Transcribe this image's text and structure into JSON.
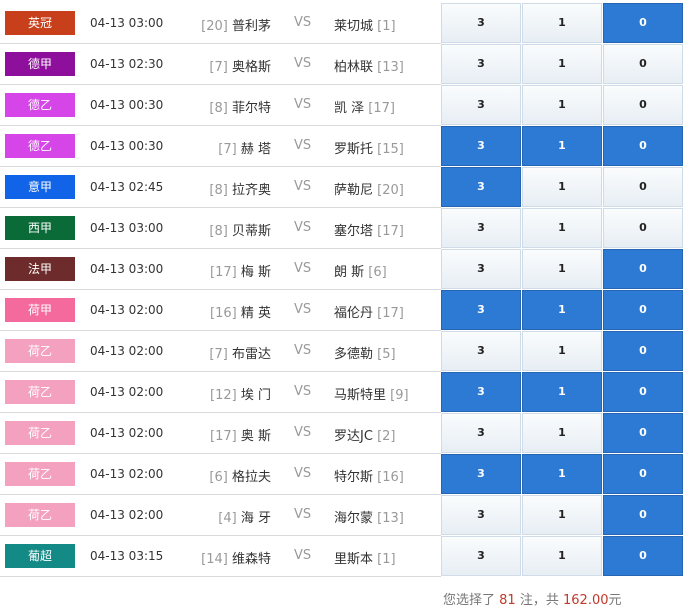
{
  "matches": [
    {
      "league": "英冠",
      "color": "#c8401b",
      "time": "04-13 03:00",
      "home_rank": "[20]",
      "home": "普利茅",
      "vs": "VS",
      "away": "莱切城",
      "away_rank": "[1]",
      "odds": [
        "3",
        "1",
        "0"
      ],
      "selected": [
        false,
        false,
        true
      ]
    },
    {
      "league": "德甲",
      "color": "#8e0f9c",
      "time": "04-13 02:30",
      "home_rank": "[7]",
      "home": "奥格斯",
      "vs": "VS",
      "away": "柏林联",
      "away_rank": "[13]",
      "odds": [
        "3",
        "1",
        "0"
      ],
      "selected": [
        false,
        false,
        false
      ]
    },
    {
      "league": "德乙",
      "color": "#d545e8",
      "time": "04-13 00:30",
      "home_rank": "[8]",
      "home": "菲尔特",
      "vs": "VS",
      "away": "凯 泽",
      "away_rank": "[17]",
      "odds": [
        "3",
        "1",
        "0"
      ],
      "selected": [
        false,
        false,
        false
      ]
    },
    {
      "league": "德乙",
      "color": "#d545e8",
      "time": "04-13 00:30",
      "home_rank": "[7]",
      "home": "赫 塔",
      "vs": "VS",
      "away": "罗斯托",
      "away_rank": "[15]",
      "odds": [
        "3",
        "1",
        "0"
      ],
      "selected": [
        true,
        true,
        true
      ]
    },
    {
      "league": "意甲",
      "color": "#1164e8",
      "time": "04-13 02:45",
      "home_rank": "[8]",
      "home": "拉齐奥",
      "vs": "VS",
      "away": "萨勒尼",
      "away_rank": "[20]",
      "odds": [
        "3",
        "1",
        "0"
      ],
      "selected": [
        true,
        false,
        false
      ]
    },
    {
      "league": "西甲",
      "color": "#0a6a38",
      "time": "04-13 03:00",
      "home_rank": "[8]",
      "home": "贝蒂斯",
      "vs": "VS",
      "away": "塞尔塔",
      "away_rank": "[17]",
      "odds": [
        "3",
        "1",
        "0"
      ],
      "selected": [
        false,
        false,
        false
      ]
    },
    {
      "league": "法甲",
      "color": "#6e2b2b",
      "time": "04-13 03:00",
      "home_rank": "[17]",
      "home": "梅 斯",
      "vs": "VS",
      "away": "朗 斯",
      "away_rank": "[6]",
      "odds": [
        "3",
        "1",
        "0"
      ],
      "selected": [
        false,
        false,
        true
      ]
    },
    {
      "league": "荷甲",
      "color": "#f46a9d",
      "time": "04-13 02:00",
      "home_rank": "[16]",
      "home": "精 英",
      "vs": "VS",
      "away": "福伦丹",
      "away_rank": "[17]",
      "odds": [
        "3",
        "1",
        "0"
      ],
      "selected": [
        true,
        true,
        true
      ]
    },
    {
      "league": "荷乙",
      "color": "#f4a0bf",
      "time": "04-13 02:00",
      "home_rank": "[7]",
      "home": "布雷达",
      "vs": "VS",
      "away": "多德勒",
      "away_rank": "[5]",
      "odds": [
        "3",
        "1",
        "0"
      ],
      "selected": [
        false,
        false,
        true
      ]
    },
    {
      "league": "荷乙",
      "color": "#f4a0bf",
      "time": "04-13 02:00",
      "home_rank": "[12]",
      "home": "埃 门",
      "vs": "VS",
      "away": "马斯特里",
      "away_rank": "[9]",
      "odds": [
        "3",
        "1",
        "0"
      ],
      "selected": [
        true,
        true,
        true
      ]
    },
    {
      "league": "荷乙",
      "color": "#f4a0bf",
      "time": "04-13 02:00",
      "home_rank": "[17]",
      "home": "奥 斯",
      "vs": "VS",
      "away": "罗达JC",
      "away_rank": "[2]",
      "odds": [
        "3",
        "1",
        "0"
      ],
      "selected": [
        false,
        false,
        true
      ]
    },
    {
      "league": "荷乙",
      "color": "#f4a0bf",
      "time": "04-13 02:00",
      "home_rank": "[6]",
      "home": "格拉夫",
      "vs": "VS",
      "away": "特尔斯",
      "away_rank": "[16]",
      "odds": [
        "3",
        "1",
        "0"
      ],
      "selected": [
        true,
        true,
        true
      ]
    },
    {
      "league": "荷乙",
      "color": "#f4a0bf",
      "time": "04-13 02:00",
      "home_rank": "[4]",
      "home": "海 牙",
      "vs": "VS",
      "away": "海尔蒙",
      "away_rank": "[13]",
      "odds": [
        "3",
        "1",
        "0"
      ],
      "selected": [
        false,
        false,
        true
      ]
    },
    {
      "league": "葡超",
      "color": "#138a86",
      "time": "04-13 03:15",
      "home_rank": "[14]",
      "home": "维森特",
      "vs": "VS",
      "away": "里斯本",
      "away_rank": "[1]",
      "odds": [
        "3",
        "1",
        "0"
      ],
      "selected": [
        false,
        false,
        true
      ]
    }
  ],
  "summary": {
    "prefix": "您选择了",
    "count": "81",
    "middle": "注，共",
    "amount": "162.00",
    "suffix": "元"
  }
}
